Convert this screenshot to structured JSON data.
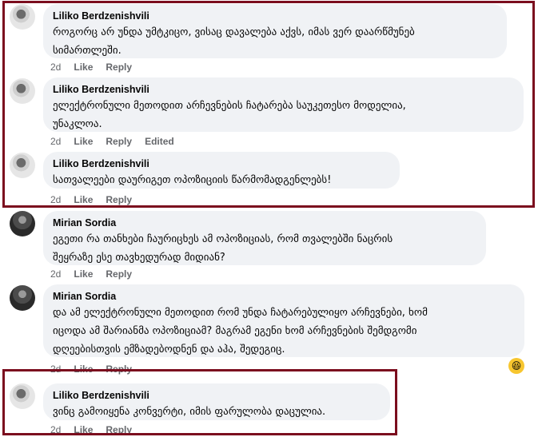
{
  "comments": [
    {
      "author": "Liliko Berdzenishvili",
      "text": "როგორც არ უნდა უმტკიცო, ვისაც დავალება აქვს, იმას ვერ დაარწმუნებ\nსიმართლეში.",
      "time": "2d",
      "like": "Like",
      "reply": "Reply",
      "edited": ""
    },
    {
      "author": "Liliko Berdzenishvili",
      "text": "ელექტრონული მეთოდით არჩევნების ჩატარება საუკეთესო მოდელია,\nუნაკლოა.",
      "time": "2d",
      "like": "Like",
      "reply": "Reply",
      "edited": "Edited"
    },
    {
      "author": "Liliko Berdzenishvili",
      "text": "სათვალეები დაურიგეთ ოპოზიციის წარმომადგენლებს!",
      "time": "2d",
      "like": "Like",
      "reply": "Reply",
      "edited": ""
    },
    {
      "author": "Mirian Sordia",
      "text": "ეგეთი რა თანხები ჩაურიცხეს ამ ოპოზიციას, რომ თვალებში ნაცრის\nშეყრაზე ესე თავხედურად მიდიან?",
      "time": "2d",
      "like": "Like",
      "reply": "Reply",
      "edited": ""
    },
    {
      "author": "Mirian Sordia",
      "text": "და ამ ელექტრონული მეთოდით რომ უნდა ჩატარებულიყო არჩევნები, ხომ\nიცოდა ამ შარიანმა ოპოზიციამ? მაგრამ ეგენი ხომ არჩევნების შემდგომი\nდღეებისთვის ემზადებოდნენ და აჰა, შედეგიც.",
      "time": "2d",
      "like": "Like",
      "reply": "Reply",
      "edited": ""
    },
    {
      "author": "Liliko Berdzenishvili",
      "text": "ვინც გამოიყენა კონვერტი, იმის ფარულობა დაცულია.",
      "time": "2d",
      "like": "Like",
      "reply": "Reply",
      "edited": ""
    }
  ],
  "reaction": {
    "emoji": "😆"
  },
  "colors": {
    "frame": "#7b0d1e",
    "bubble": "#f0f2f5",
    "meta": "#65676b"
  }
}
